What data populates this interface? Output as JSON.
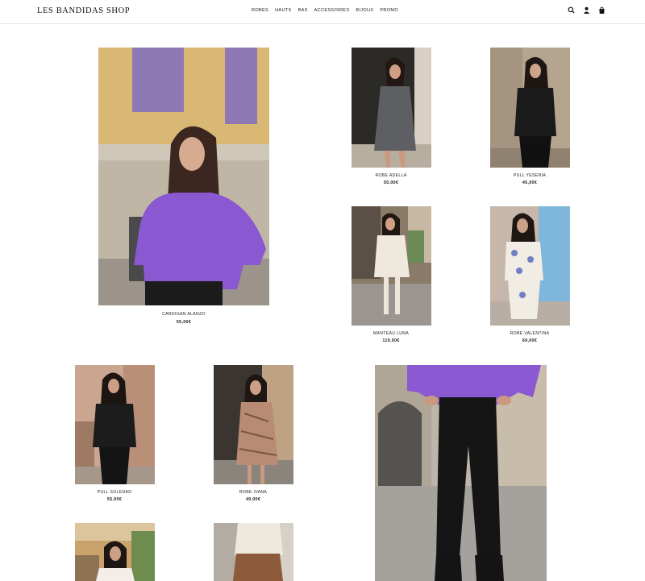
{
  "brand": "LES BANDIDAS SHOP",
  "nav": [
    "ROBES",
    "HAUTS",
    "BAS",
    "ACCESSOIRES",
    "BIJOUX",
    "PROMO"
  ],
  "header_icons": [
    "search-icon",
    "account-icon",
    "cart-icon"
  ],
  "products": [
    {
      "name": "CARDIGAN ALANZO",
      "price": "55,00€"
    },
    {
      "name": "ROBE ADELLA",
      "price": "55,00€"
    },
    {
      "name": "PULL YESENIA",
      "price": "45,00€"
    },
    {
      "name": "MANTEAU LUNA",
      "price": "119,00€"
    },
    {
      "name": "ROBE VALENTINA",
      "price": "69,00€"
    },
    {
      "name": "PULL SOLEDAD",
      "price": "55,00€"
    },
    {
      "name": "ROBE IVANA",
      "price": "49,00€"
    }
  ],
  "colors": {
    "accent": "#8a58d0",
    "text": "#111111",
    "divider": "#e6e6e6"
  }
}
